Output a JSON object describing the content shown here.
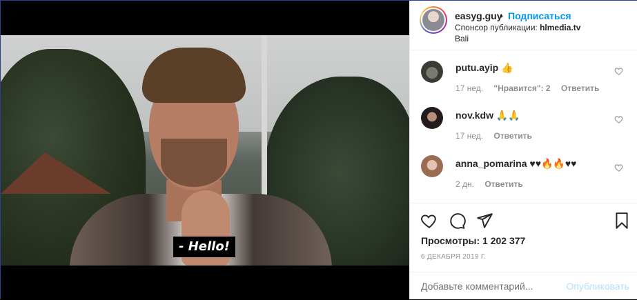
{
  "video": {
    "subtitle": "- Hello!"
  },
  "header": {
    "username": "easyg.guy",
    "separator": "•",
    "follow_label": "Подписаться",
    "sponsor_prefix": "Спонсор публикации: ",
    "sponsor_name": "hlmedia.tv",
    "location": "Bali"
  },
  "comments": [
    {
      "username": "putu.ayip",
      "text": "👍",
      "age": "17 нед.",
      "likes": "\"Нравится\": 2",
      "reply": "Ответить"
    },
    {
      "username": "nov.kdw",
      "text": "🙏🙏",
      "age": "17 нед.",
      "reply": "Ответить"
    },
    {
      "username": "anna_pomarina",
      "text": "♥♥🔥🔥♥♥",
      "age": "2 дн.",
      "reply": "Ответить"
    }
  ],
  "actions": {
    "views": "Просмотры: 1 202 377",
    "date": "6 ДЕКАБРЯ 2019 Г."
  },
  "add_comment": {
    "placeholder": "Добавьте комментарий...",
    "publish_label": "Опубликовать"
  },
  "colors": {
    "accent": "#0095f6",
    "publish_disabled": "#b2dffc",
    "border": "#2d3e9a"
  }
}
